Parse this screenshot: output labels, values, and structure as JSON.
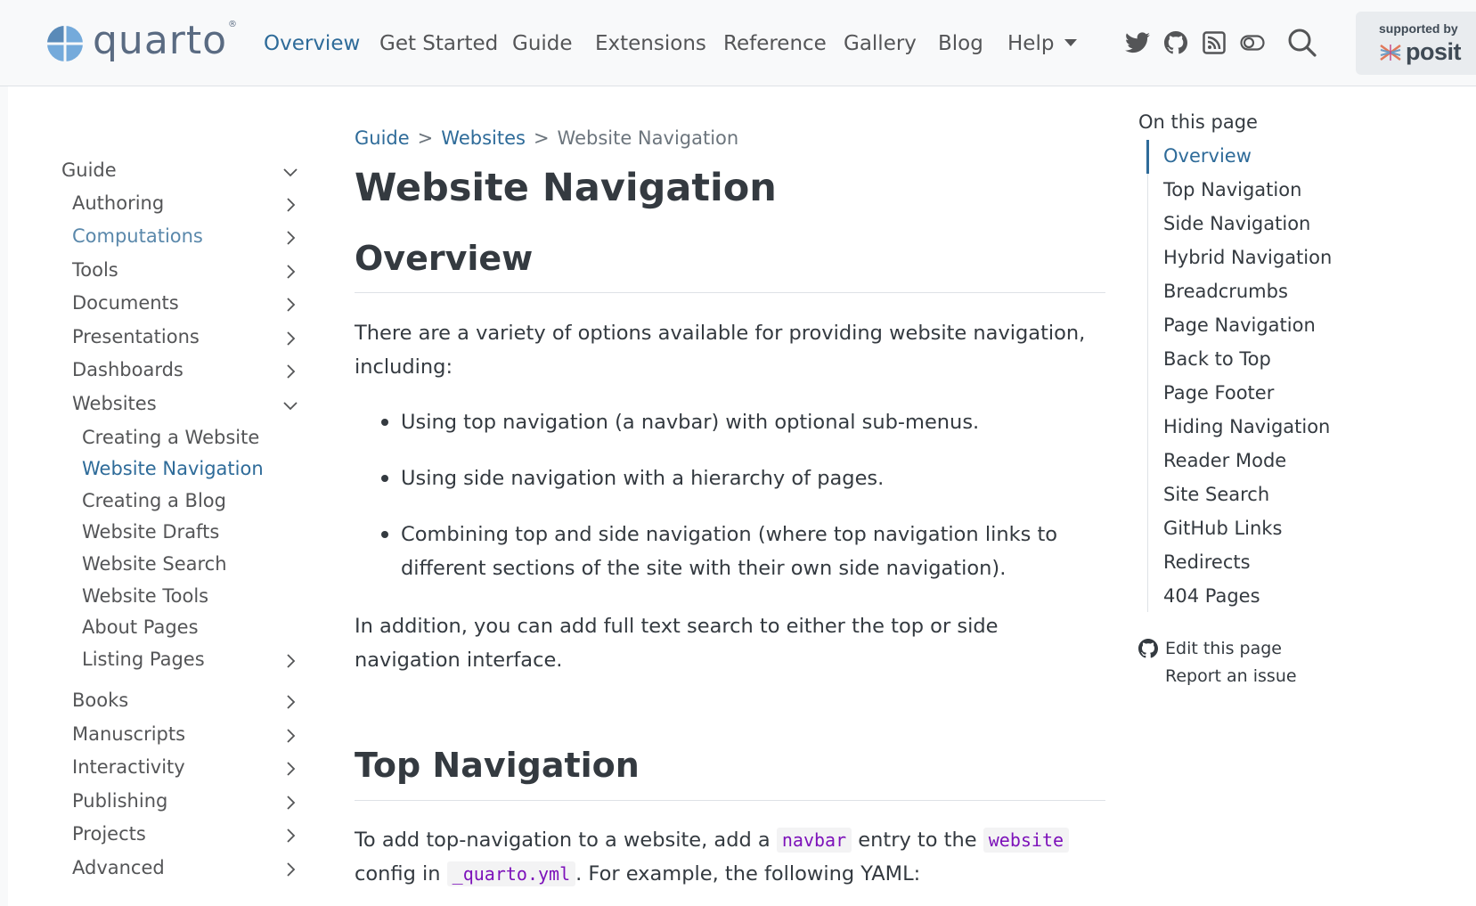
{
  "brand": {
    "name": "quarto",
    "reg": "®"
  },
  "nav": {
    "links": [
      "Overview",
      "Get Started",
      "Guide",
      "Extensions",
      "Reference",
      "Gallery",
      "Blog",
      "Help"
    ],
    "active": "Overview",
    "icons": [
      "twitter-icon",
      "github-icon",
      "rss-icon",
      "toggle-icon",
      "search-icon"
    ]
  },
  "sponsor": {
    "label": "supported by",
    "name": "posit"
  },
  "sidebar": {
    "section": "Guide",
    "items": [
      "Authoring",
      "Computations",
      "Tools",
      "Documents",
      "Presentations",
      "Dashboards",
      "Websites"
    ],
    "websites_children": [
      "Creating a Website",
      "Website Navigation",
      "Creating a Blog",
      "Website Drafts",
      "Website Search",
      "Website Tools",
      "About Pages",
      "Listing Pages"
    ],
    "items_after": [
      "Books",
      "Manuscripts",
      "Interactivity",
      "Publishing",
      "Projects",
      "Advanced"
    ],
    "active": "Website Navigation"
  },
  "breadcrumb": {
    "items": [
      "Guide",
      "Websites",
      "Website Navigation"
    ],
    "sep": ">"
  },
  "content": {
    "title": "Website Navigation",
    "overview_heading": "Overview",
    "overview_intro": "There are a variety of options available for providing website navigation, including:",
    "bullets": [
      "Using top navigation (a navbar) with optional sub-menus.",
      "Using side navigation with a hierarchy of pages.",
      "Combining top and side navigation (where top navigation links to different sections of the site with their own side navigation)."
    ],
    "overview_outro": "In addition, you can add full text search to either the top or side navigation interface.",
    "topnav_heading": "Top Navigation",
    "topnav_p1_a": "To add top-navigation to a website, add a ",
    "topnav_code1": "navbar",
    "topnav_p1_b": " entry to the ",
    "topnav_code2": "website",
    "topnav_p1_c": " config in ",
    "topnav_code3": "_quarto.yml",
    "topnav_p1_d": ". For example, the following YAML:"
  },
  "toc": {
    "title": "On this page",
    "items": [
      "Overview",
      "Top Navigation",
      "Side Navigation",
      "Hybrid Navigation",
      "Breadcrumbs",
      "Page Navigation",
      "Back to Top",
      "Page Footer",
      "Hiding Navigation",
      "Reader Mode",
      "Site Search",
      "GitHub Links",
      "Redirects",
      "404 Pages"
    ],
    "active": "Overview",
    "edit_label": "Edit this page",
    "issue_label": "Report an issue"
  },
  "colors": {
    "accent": "#2e6b99",
    "text": "#343a40",
    "muted": "#545557",
    "code": "#7d12ba"
  }
}
